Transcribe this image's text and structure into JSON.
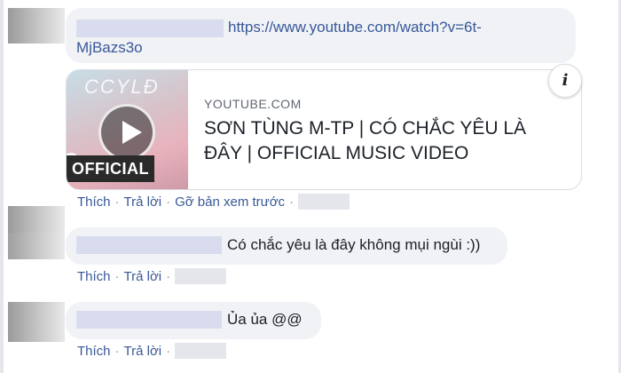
{
  "comments": [
    {
      "link_text_line1": "https://www.youtube.com/watch?v=6t-",
      "link_text_line2": "MjBazs3o",
      "preview": {
        "site": "YOUTUBE.COM",
        "title": "SƠN TÙNG M-TP | CÓ CHẮC YÊU LÀ ĐÂY | OFFICIAL MUSIC VIDEO",
        "thumb_badge": "OFFICIAL",
        "thumb_q": "?",
        "thumb_logo": "CCYLĐ",
        "info_icon": "i"
      },
      "actions": {
        "like": "Thích",
        "reply": "Trả lời",
        "remove_preview": "Gỡ bản xem trước",
        "sep": "·"
      }
    },
    {
      "text": "Có chắc yêu là đây không mụi ngùi :))",
      "actions": {
        "like": "Thích",
        "reply": "Trả lời",
        "sep": "·"
      }
    },
    {
      "text": "Ủa ủa @@",
      "actions": {
        "like": "Thích",
        "reply": "Trả lời",
        "sep": "·"
      }
    }
  ],
  "icons": {
    "play": "play-icon",
    "info": "info-icon"
  },
  "colors": {
    "link": "#385898",
    "bubble": "#f0f2f5",
    "redaction": "#d9dcef"
  }
}
